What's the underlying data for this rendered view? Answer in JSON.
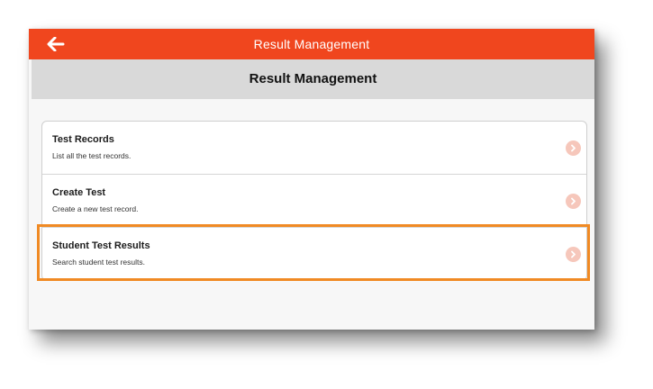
{
  "header": {
    "title": "Result Management",
    "back_icon": "arrow-left-icon",
    "background_color": "#f0461e"
  },
  "subheader": {
    "title": "Result Management",
    "background_color": "#d9d9d9"
  },
  "menu": {
    "items": [
      {
        "title": "Test Records",
        "description": "List all the test records.",
        "icon": "chevron-right-icon"
      },
      {
        "title": "Create Test",
        "description": "Create a new test record.",
        "icon": "chevron-right-icon"
      },
      {
        "title": "Student Test Results",
        "description": "Search student test results.",
        "icon": "chevron-right-icon",
        "highlighted": true
      }
    ]
  },
  "colors": {
    "accent": "#f0461e",
    "highlight": "#f08a24",
    "chevron": "#f6c7bb"
  }
}
